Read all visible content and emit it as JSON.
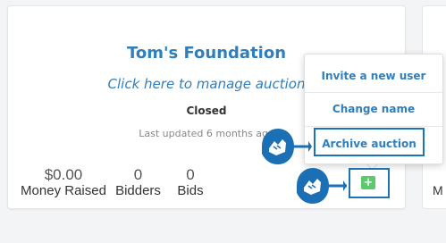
{
  "auction_card": {
    "title": "Tom's Foundation",
    "manage_link": "Click here to manage auction",
    "status": "Closed",
    "last_updated": "Last updated 6 months ago",
    "stats": {
      "money_raised_value": "$0.00",
      "money_raised_label": "Money Raised",
      "bidders_value": "0",
      "bidders_label": "Bidders",
      "bids_value": "0",
      "bids_label": "Bids"
    }
  },
  "menu": {
    "items": [
      {
        "label": "Invite a new user"
      },
      {
        "label": "Change name"
      },
      {
        "label": "Archive auction"
      }
    ]
  },
  "menu_button": {
    "icon": "plus-icon",
    "glyph": "+"
  },
  "next_card": {
    "partial_label": "M"
  },
  "colors": {
    "accent": "#2f7fbd",
    "highlight_border": "#1d73b8",
    "menu_button": "#5cc96b",
    "pointer_bubble": "#1a6fb5"
  },
  "tutorial_pointers": [
    {
      "icon": "pointing-hand-icon",
      "target": "Archive auction"
    },
    {
      "icon": "pointing-hand-icon",
      "target": "plus-icon"
    }
  ]
}
